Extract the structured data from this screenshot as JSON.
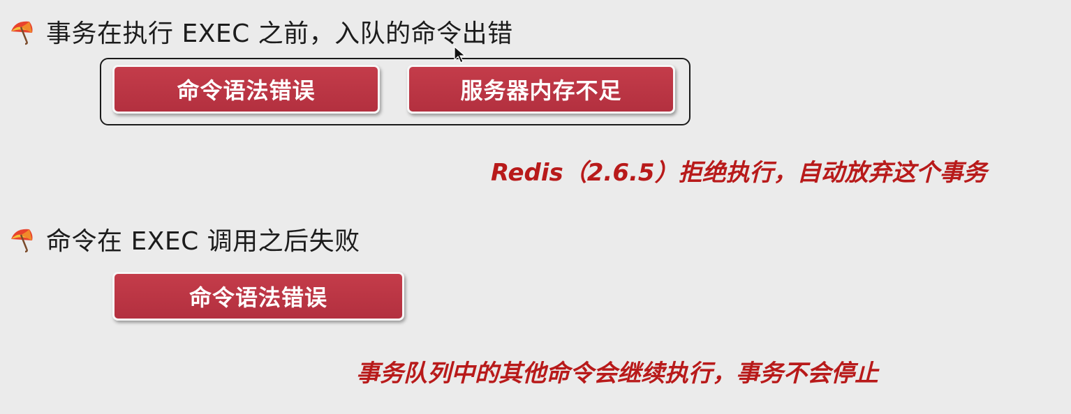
{
  "section1": {
    "title": "事务在执行 EXEC 之前，入队的命令出错",
    "icon": "umbrella-icon",
    "buttons": [
      "命令语法错误",
      "服务器内存不足"
    ],
    "note": "Redis（2.6.5）拒绝执行，自动放弃这个事务"
  },
  "section2": {
    "title": "命令在 EXEC 调用之后失败",
    "icon": "umbrella-icon",
    "buttons": [
      "命令语法错误"
    ],
    "note": "事务队列中的其他命令会继续执行，事务不会停止"
  },
  "colors": {
    "background": "#ebebeb",
    "button_red": "#b8333f",
    "note_red": "#b81a1a"
  }
}
